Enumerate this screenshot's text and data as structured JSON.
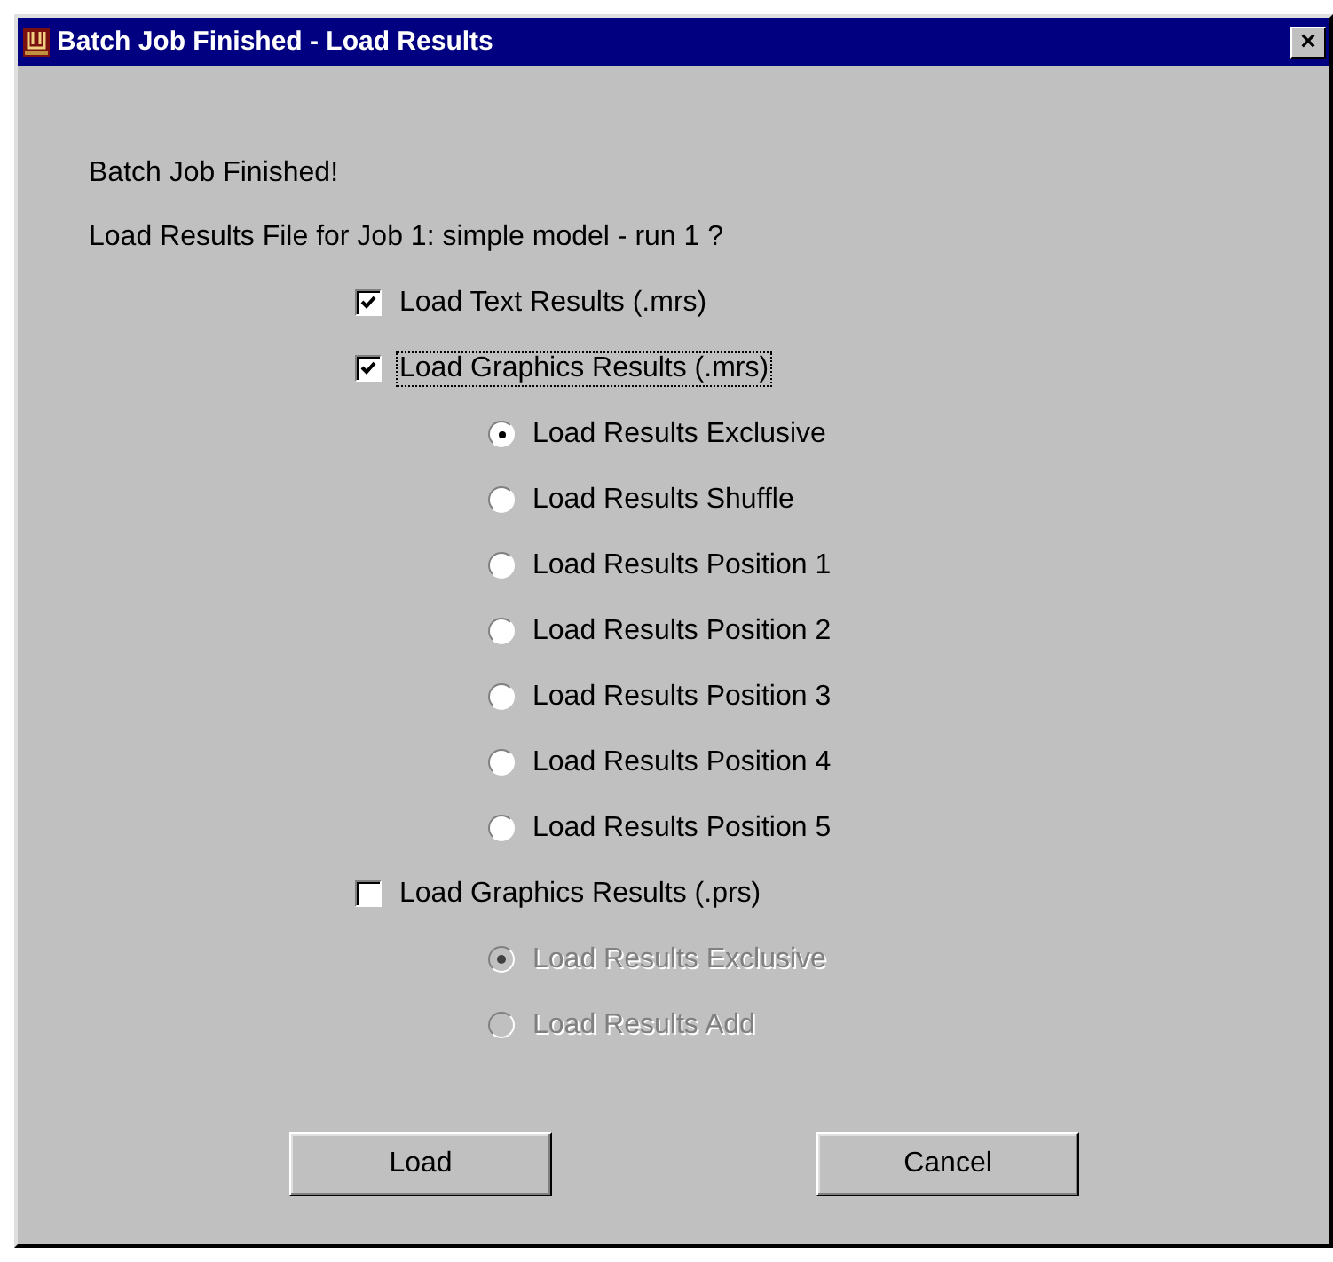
{
  "window": {
    "title": "Batch Job Finished - Load Results",
    "close": "×"
  },
  "messages": [
    "Batch Job Finished!",
    "Load Results File for Job 1: simple model - run 1 ?"
  ],
  "options": [
    {
      "kind": "checkbox",
      "label": "Load Text Results (.mrs)",
      "checked": true,
      "focused": false
    },
    {
      "kind": "checkbox",
      "label": "Load Graphics Results (.mrs)",
      "checked": true,
      "focused": true,
      "children": [
        {
          "kind": "radio",
          "label": "Load Results Exclusive",
          "selected": true,
          "disabled": false
        },
        {
          "kind": "radio",
          "label": "Load Results Shuffle",
          "selected": false,
          "disabled": false
        },
        {
          "kind": "radio",
          "label": "Load Results Position 1",
          "selected": false,
          "disabled": false
        },
        {
          "kind": "radio",
          "label": "Load Results Position 2",
          "selected": false,
          "disabled": false
        },
        {
          "kind": "radio",
          "label": "Load Results Position 3",
          "selected": false,
          "disabled": false
        },
        {
          "kind": "radio",
          "label": "Load Results Position 4",
          "selected": false,
          "disabled": false
        },
        {
          "kind": "radio",
          "label": "Load Results Position 5",
          "selected": false,
          "disabled": false
        }
      ]
    },
    {
      "kind": "checkbox",
      "label": "Load Graphics Results (.prs)",
      "checked": false,
      "focused": false,
      "children": [
        {
          "kind": "radio",
          "label": "Load Results Exclusive",
          "selected": true,
          "disabled": true
        },
        {
          "kind": "radio",
          "label": "Load Results Add",
          "selected": false,
          "disabled": true
        }
      ]
    }
  ],
  "buttons": [
    "Load",
    "Cancel"
  ]
}
